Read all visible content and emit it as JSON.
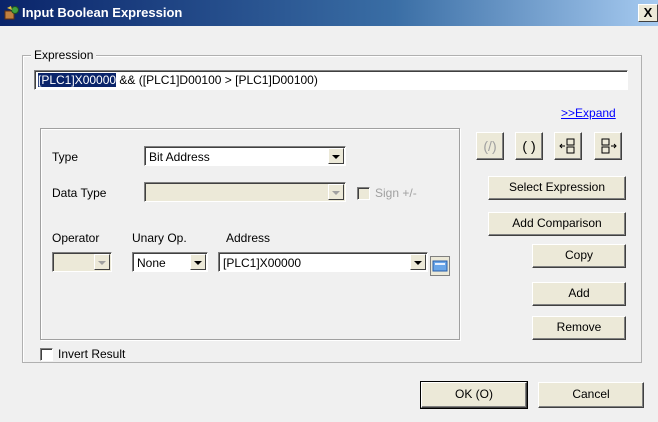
{
  "window": {
    "title": "Input Boolean Expression",
    "close_label": "X"
  },
  "expression": {
    "group_label": "Expression",
    "selected_token": "[PLC1]X00000",
    "rest": " && ([PLC1]D00100 > [PLC1]D00100)",
    "expand_link": ">>Expand"
  },
  "form": {
    "type_label": "Type",
    "type_value": "Bit Address",
    "data_type_label": "Data Type",
    "data_type_value": "",
    "sign_label": "Sign +/-",
    "operator_label": "Operator",
    "operator_value": "",
    "unary_label": "Unary Op.",
    "unary_value": "None",
    "address_label": "Address",
    "address_value": "[PLC1]X00000"
  },
  "toolbar": {
    "not_icon": "(/)",
    "paren_icon": "( )",
    "move_left_icon": "move-left-icon",
    "move_right_icon": "move-right-icon"
  },
  "buttons": {
    "select_expression": "Select Expression",
    "add_comparison": "Add Comparison",
    "copy": "Copy",
    "add": "Add",
    "remove": "Remove",
    "ok": "OK (O)",
    "cancel": "Cancel"
  },
  "invert": {
    "label": "Invert Result"
  },
  "colors": {
    "title_bar": "#0a246a",
    "dialog_bg": "#f0f0f0",
    "selection": "#0a246a",
    "link": "#0000ff"
  }
}
